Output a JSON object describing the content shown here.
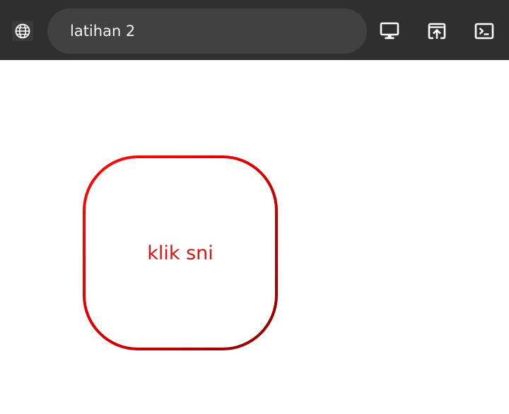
{
  "browser_bar": {
    "address_text": "latihan 2",
    "icons": {
      "site": "globe-icon",
      "desktop": "monitor-icon",
      "open_external": "open-in-new-window-icon",
      "console": "terminal-icon"
    },
    "colors": {
      "bar_background": "#2f2f2f",
      "address_background": "#414141",
      "foreground": "#ffffff"
    }
  },
  "page": {
    "button_label": "klik sni",
    "colors": {
      "button_border_gradient": [
        "#ff0a0a",
        "#8a0000"
      ],
      "button_text": "#dc1414",
      "background": "#ffffff"
    }
  }
}
